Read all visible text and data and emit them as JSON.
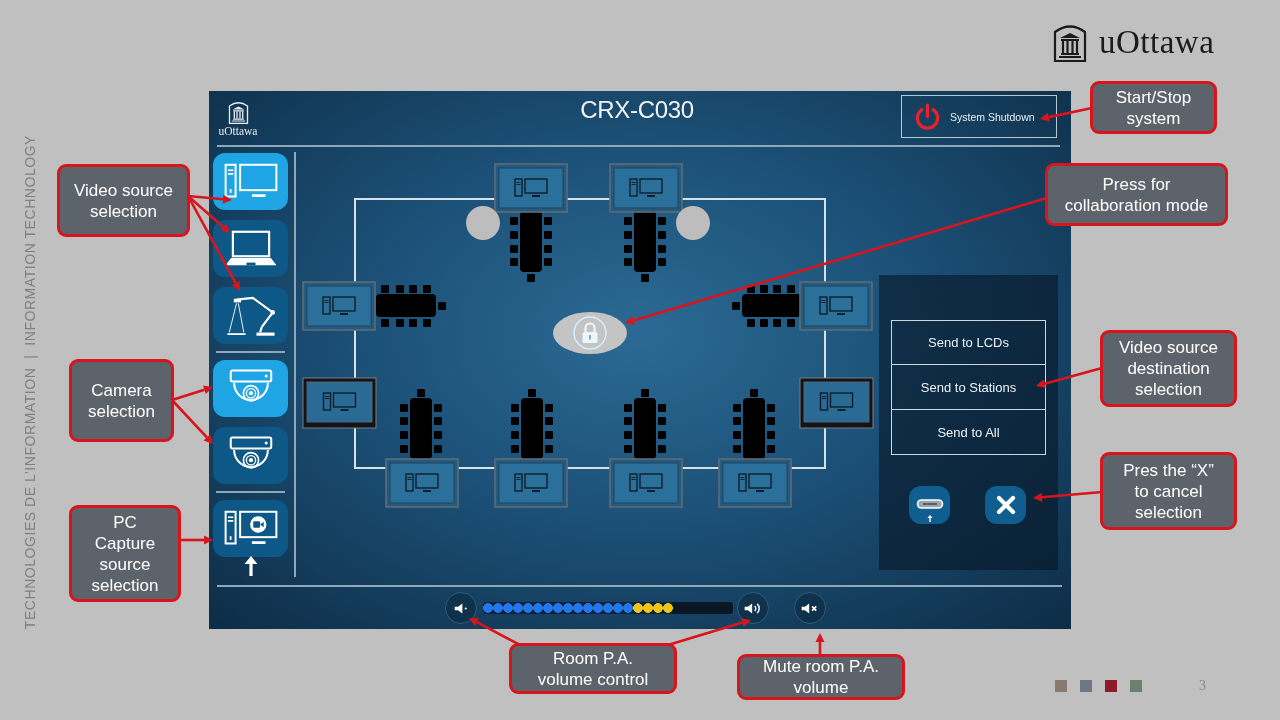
{
  "slide": {
    "logo": "uOttawa",
    "side_label": "TECHNOLOGIES DE L’INFORMATION  |  INFORMATION TECHNOLOGY",
    "page_number": "3"
  },
  "panel": {
    "logo": "uOttawa",
    "title": "CRX-C030",
    "shutdown_button": "System Shutdown",
    "sidebar": [
      {
        "buttons": [
          {
            "kind": "desktop",
            "selected": true
          },
          {
            "kind": "laptop",
            "selected": false
          },
          {
            "kind": "document_camera",
            "selected": false
          }
        ]
      },
      {
        "buttons": [
          {
            "kind": "camera",
            "selected": true
          },
          {
            "kind": "camera",
            "selected": false
          }
        ]
      },
      {
        "buttons": [
          {
            "kind": "pc_capture",
            "selected": false
          }
        ]
      }
    ],
    "collaboration_lock": {
      "locked": true
    },
    "destination_buttons": [
      "Send to LCDs",
      "Send to Stations",
      "Send to All"
    ],
    "volume": {
      "level": 0.76
    }
  },
  "callouts": [
    {
      "lines": [
        "Start/Stop",
        "system"
      ]
    },
    {
      "lines": [
        "Video source",
        "selection"
      ]
    },
    {
      "lines": [
        "Press for",
        "collaboration mode"
      ]
    },
    {
      "lines": [
        "Camera",
        "selection"
      ]
    },
    {
      "lines": [
        "Video source",
        "destination",
        "selection"
      ]
    },
    {
      "lines": [
        "PC",
        "Capture",
        "source",
        "selection"
      ]
    },
    {
      "lines": [
        "Pres the “X”",
        "to cancel",
        "selection"
      ]
    },
    {
      "lines": [
        "Room P.A.",
        "volume control"
      ]
    },
    {
      "lines": [
        "Mute room P.A.",
        "volume"
      ]
    }
  ]
}
